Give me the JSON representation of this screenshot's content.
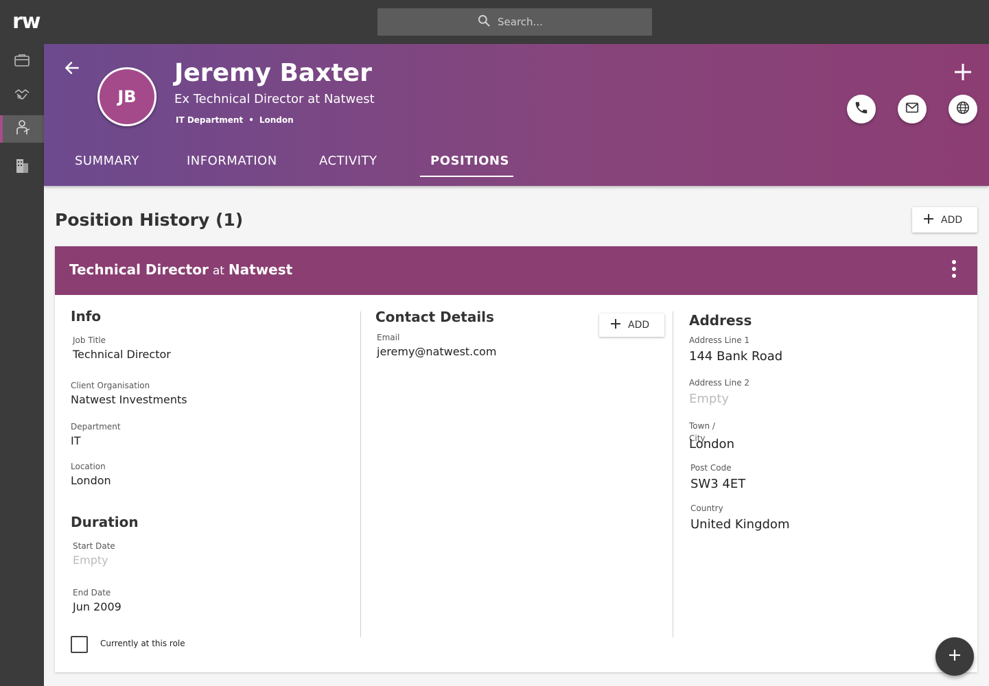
{
  "app": {
    "logo": "rw"
  },
  "search": {
    "placeholder": "Search..."
  },
  "sidebar": {
    "items": [
      {
        "icon": "briefcase-icon"
      },
      {
        "icon": "handshake-icon"
      },
      {
        "icon": "person-icon",
        "active": true
      },
      {
        "icon": "building-icon"
      }
    ]
  },
  "profile": {
    "initials": "JB",
    "name": "Jeremy Baxter",
    "subtitle": "Ex Technical Director at Natwest",
    "department": "IT Department",
    "separator": "•",
    "location": "London"
  },
  "tabs": [
    {
      "label": "SUMMARY"
    },
    {
      "label": "INFORMATION"
    },
    {
      "label": "ACTIVITY"
    },
    {
      "label": "POSITIONS",
      "active": true
    }
  ],
  "positions": {
    "title": "Position History (1)",
    "add_label": "ADD",
    "card": {
      "role": "Technical Director",
      "at": "at",
      "company": "Natwest",
      "info": {
        "heading": "Info",
        "job_title_label": "Job Title",
        "job_title": "Technical Director",
        "client_org_label": "Client Organisation",
        "client_org": "Natwest Investments",
        "department_label": "Department",
        "department": "IT",
        "location_label": "Location",
        "location": "London"
      },
      "duration": {
        "heading": "Duration",
        "start_label": "Start Date",
        "start": "Empty",
        "end_label": "End Date",
        "end": "Jun 2009",
        "current_label": "Currently at this role",
        "current_checked": false
      },
      "contact": {
        "heading": "Contact Details",
        "add_label": "ADD",
        "email_label": "Email",
        "email": "jeremy@natwest.com"
      },
      "address": {
        "heading": "Address",
        "line1_label": "Address Line 1",
        "line1": "144 Bank Road",
        "line2_label": "Address Line 2",
        "line2": "Empty",
        "town_label_1": "Town /",
        "town_label_2": "City",
        "town": "London",
        "postcode_label": "Post Code",
        "postcode": "SW3 4ET",
        "country_label": "Country",
        "country": "United Kingdom"
      }
    }
  },
  "colors": {
    "header_start": "#6c4a8e",
    "header_end": "#8c3e73",
    "card_header": "#8a3e71",
    "avatar": "#a44a8b",
    "topbar": "#3b3b3b"
  }
}
